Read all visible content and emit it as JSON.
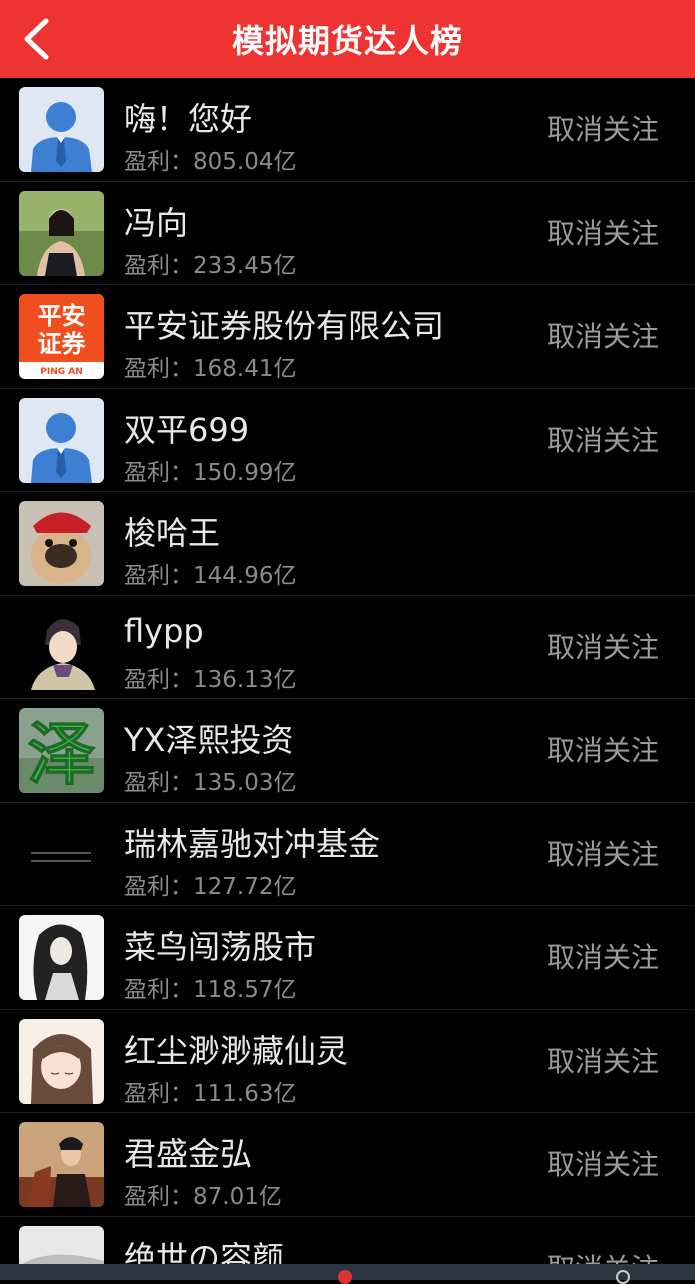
{
  "header": {
    "title": "模拟期货达人榜",
    "back_icon": "chevron-left-icon"
  },
  "colors": {
    "header_bg": "#ee3333",
    "background": "#000000",
    "name_text": "#e8e8e8",
    "profit_text": "#8b8b8b",
    "action_text": "#9a9a9a"
  },
  "profit_label": "盈利：",
  "rows": [
    {
      "name": "嗨！您好",
      "profit": "盈利：805.04亿",
      "action": "取消关注",
      "avatar": "default-user-avatar"
    },
    {
      "name": "冯向",
      "profit": "盈利：233.45亿",
      "action": "取消关注",
      "avatar": "photo-avatar"
    },
    {
      "name": "平安证券股份有限公司",
      "profit": "盈利：168.41亿",
      "action": "取消关注",
      "avatar": "pingan-logo-avatar",
      "logo_text_top": "平安",
      "logo_text_bottom": "证券",
      "logo_sub": "PING AN"
    },
    {
      "name": "双平699",
      "profit": "盈利：150.99亿",
      "action": "取消关注",
      "avatar": "default-user-avatar"
    },
    {
      "name": "梭哈王",
      "profit": "盈利：144.96亿",
      "action": "",
      "avatar": "dog-avatar"
    },
    {
      "name": "flypp",
      "profit": "盈利：136.13亿",
      "action": "取消关注",
      "avatar": "cartoon-avatar"
    },
    {
      "name": "YX泽熙投资",
      "profit": "盈利：135.03亿",
      "action": "取消关注",
      "avatar": "ze-character-avatar",
      "logo_char": "泽"
    },
    {
      "name": "瑞林嘉驰对冲基金",
      "profit": "盈利：127.72亿",
      "action": "取消关注",
      "avatar": "dark-text-avatar"
    },
    {
      "name": "菜鸟闯荡股市",
      "profit": "盈利：118.57亿",
      "action": "取消关注",
      "avatar": "ink-drawing-avatar"
    },
    {
      "name": "红尘渺渺藏仙灵",
      "profit": "盈利：111.63亿",
      "action": "取消关注",
      "avatar": "anime-avatar"
    },
    {
      "name": "君盛金弘",
      "profit": "盈利：87.01亿",
      "action": "取消关注",
      "avatar": "warrior-avatar"
    },
    {
      "name": "绝世の容颜",
      "profit": "",
      "action": "取消关注",
      "avatar": "grey-photo-avatar"
    }
  ]
}
